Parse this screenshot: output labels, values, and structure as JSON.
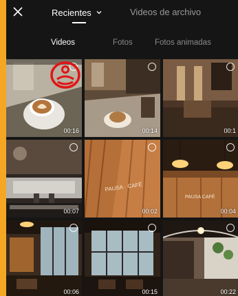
{
  "header": {
    "close_icon": "close-icon",
    "tab_recent": "Recientes",
    "tab_recent_icon": "chevron-down-icon",
    "tab_archive": "Videos de archivo"
  },
  "subtabs": {
    "videos": "Videos",
    "photos": "Fotos",
    "animated": "Fotos animadas"
  },
  "gallery": {
    "items": [
      {
        "duration": "00:16"
      },
      {
        "duration": "00:14"
      },
      {
        "duration": "00:1"
      },
      {
        "duration": "00:07"
      },
      {
        "duration": "00:02"
      },
      {
        "duration": "00:04"
      },
      {
        "duration": "00:06"
      },
      {
        "duration": "00:15"
      },
      {
        "duration": "00:22"
      }
    ]
  },
  "colors": {
    "background_frame": "#f5a623",
    "app_background": "#151515",
    "annotation_red": "#e01515"
  }
}
